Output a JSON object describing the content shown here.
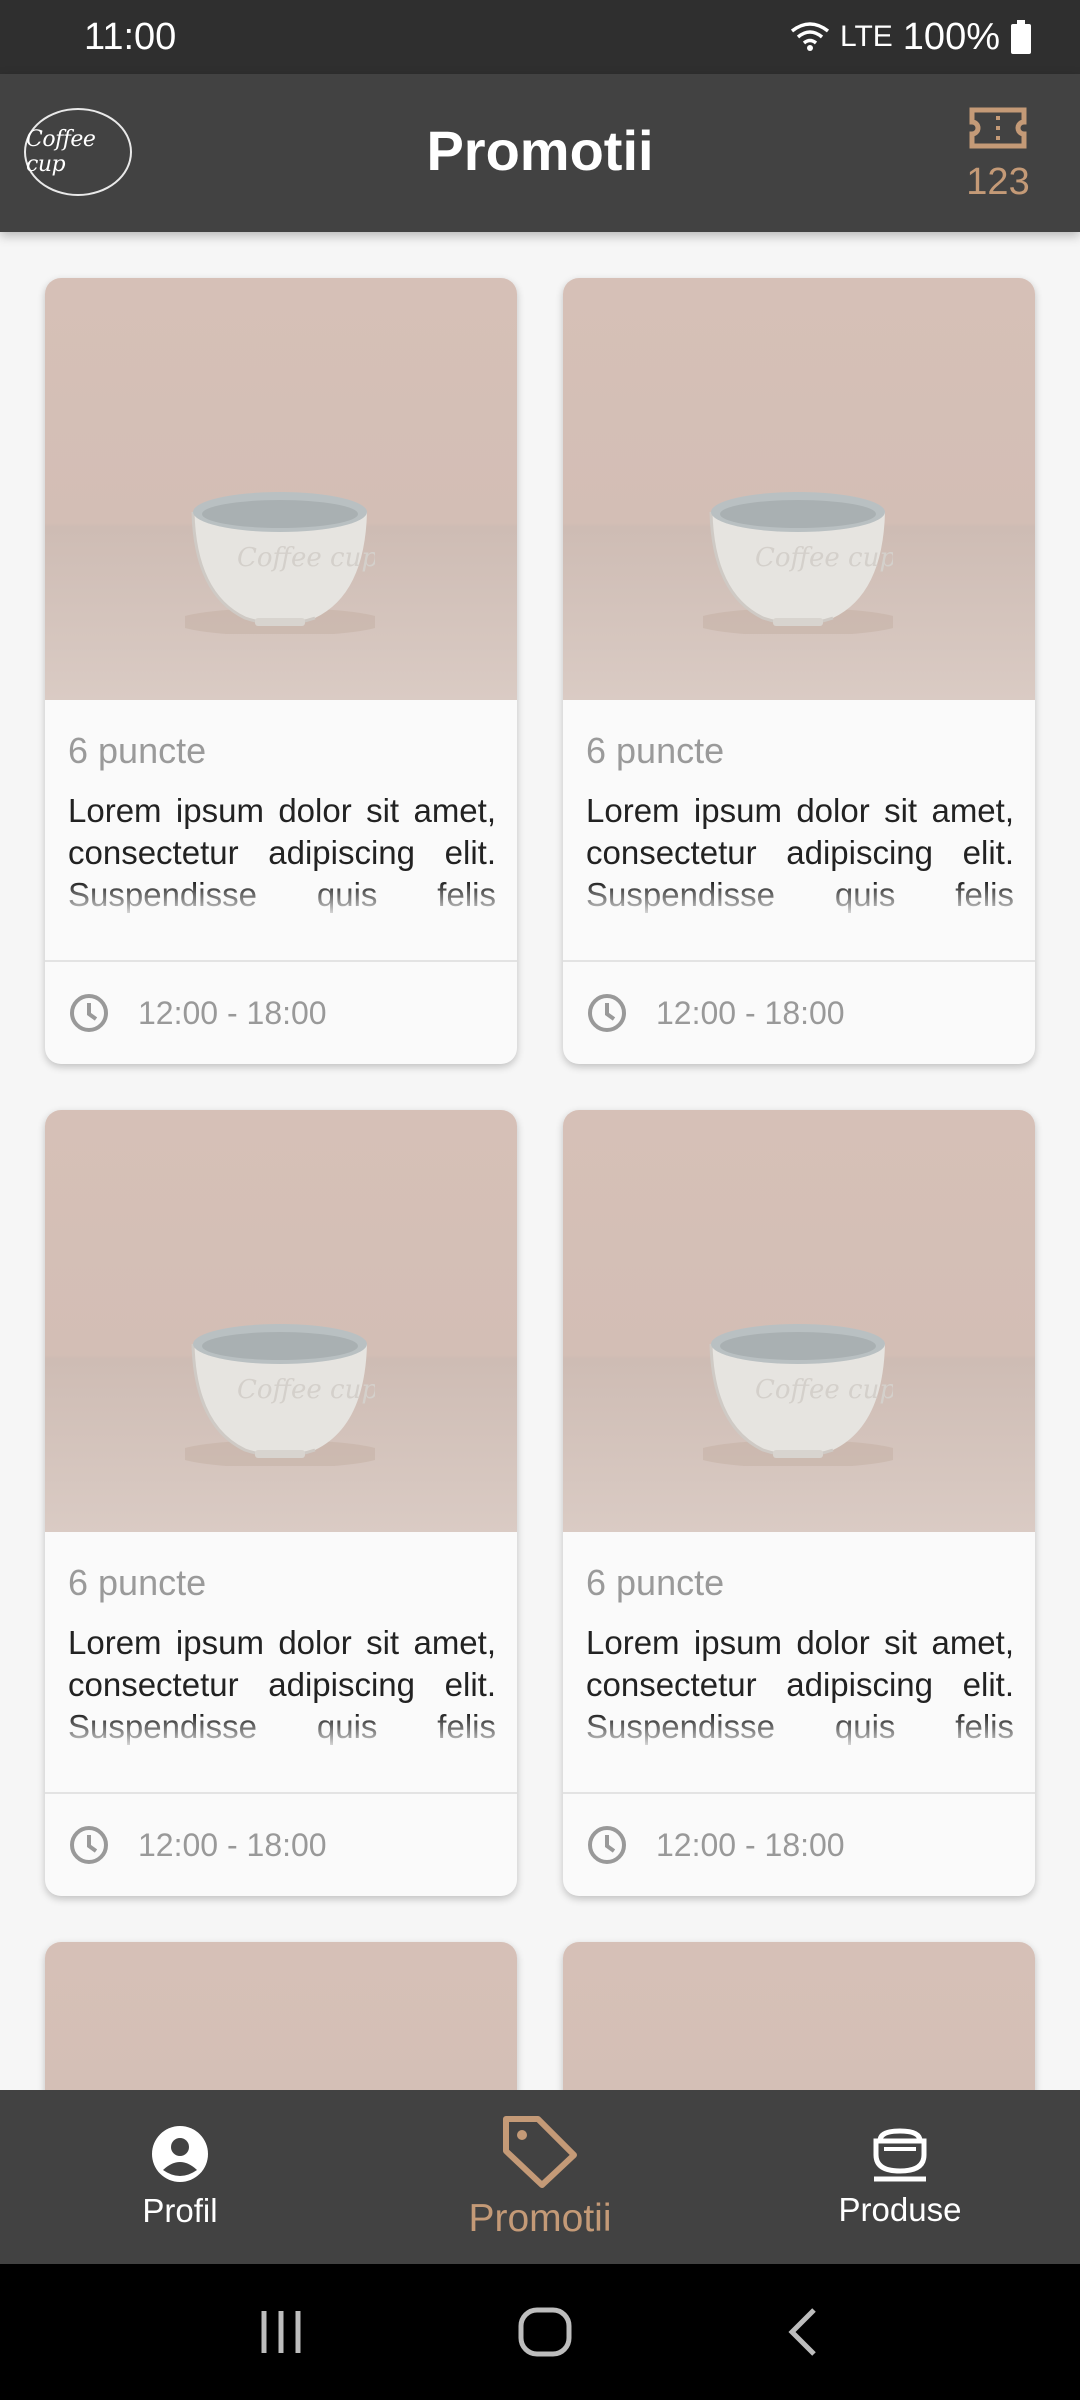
{
  "status_bar": {
    "time": "11:00",
    "network": "LTE",
    "battery": "100%",
    "icons": [
      "wifi-icon",
      "battery-icon"
    ]
  },
  "header": {
    "logo_text": "Coffee cup",
    "title": "Promotii",
    "points_icon": "ticket-icon",
    "points_value": "123"
  },
  "promotions": [
    {
      "points": "6 puncte",
      "description": "Lorem ipsum dolor sit amet, consectetur adipiscing elit. Suspendisse quis felis ullamcorper, varius elit nec",
      "time": "12:00 - 18:00",
      "image": "coffee-cup-photo"
    },
    {
      "points": "6 puncte",
      "description": "Lorem ipsum dolor sit amet, consectetur adipiscing elit. Suspendisse quis felis ullamcorper, varius elit nec",
      "time": "12:00 - 18:00",
      "image": "coffee-cup-photo"
    },
    {
      "points": "6 puncte",
      "description": "Lorem ipsum dolor sit amet, consectetur adipiscing elit. Suspendisse quis felis ullamcorper, varius elit nec",
      "time": "12:00 - 18:00",
      "image": "coffee-cup-photo"
    },
    {
      "points": "6 puncte",
      "description": "Lorem ipsum dolor sit amet, consectetur adipiscing elit. Suspendisse quis felis ullamcorper, varius elit nec",
      "time": "12:00 - 18:00",
      "image": "coffee-cup-photo"
    }
  ],
  "bottom_nav": {
    "items": [
      {
        "label": "Profil",
        "icon": "profile-icon",
        "active": false
      },
      {
        "label": "Promotii",
        "icon": "tag-icon",
        "active": true
      },
      {
        "label": "Produse",
        "icon": "coffee-cup-icon",
        "active": false
      }
    ]
  },
  "system_nav": {
    "icons": [
      "recent-apps-icon",
      "home-icon",
      "back-icon"
    ]
  },
  "colors": {
    "accent": "#c49a77",
    "header_bg": "#424242",
    "status_bar_bg": "#2f2f2f",
    "page_bg": "#f6f6f6"
  }
}
